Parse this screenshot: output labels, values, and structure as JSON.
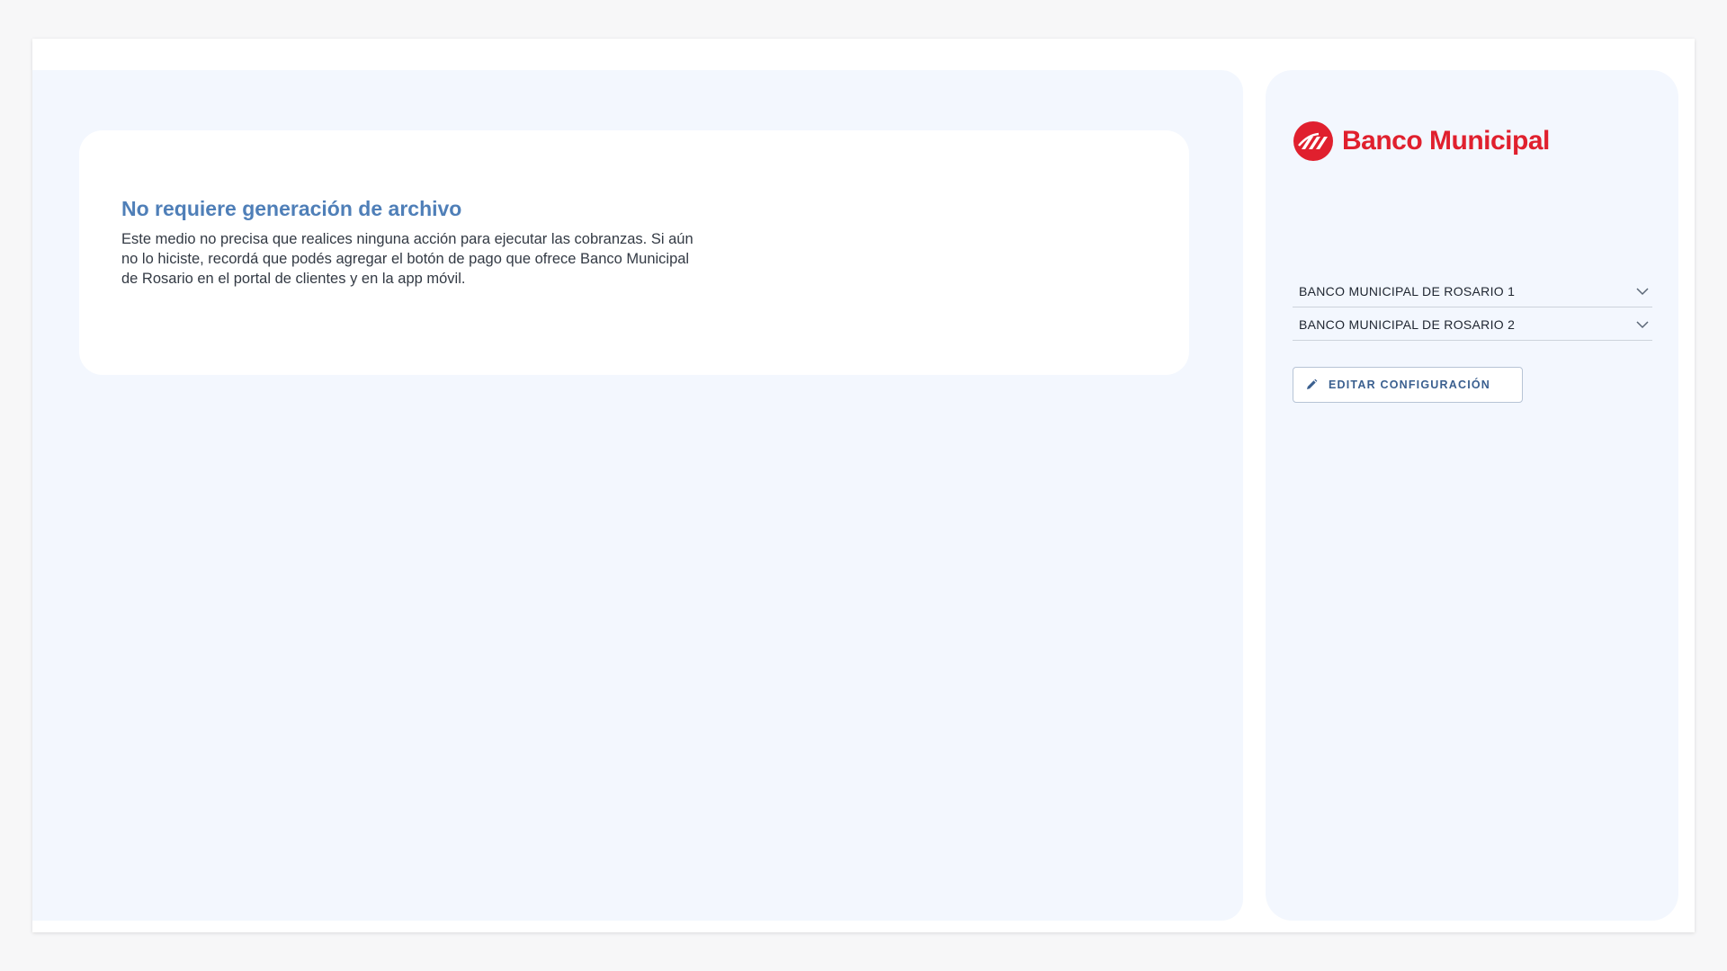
{
  "card": {
    "title": "No requiere generación de archivo",
    "body": "Este medio no precisa que realices ninguna acción para ejecutar las cobranzas. Si aún no lo hiciste, recordá que podés agregar el botón de pago que ofrece Banco Municipal de Rosario en el portal de clientes y en la app móvil."
  },
  "sidebar": {
    "logo": {
      "text": "Banco Municipal",
      "icon": "banco-municipal-logo-icon",
      "color": "#e0202e"
    },
    "accounts": [
      {
        "label": "BANCO MUNICIPAL DE ROSARIO 1",
        "icon": "chevron-down-icon"
      },
      {
        "label": "BANCO MUNICIPAL DE ROSARIO 2",
        "icon": "chevron-down-icon"
      }
    ],
    "edit_button": {
      "label": "EDITAR CONFIGURACIÓN",
      "icon": "pencil-icon"
    }
  },
  "colors": {
    "page_background": "#f7f7f8",
    "panel_background": "#f3f7fe",
    "title_blue": "#4f7fb8",
    "brand_red": "#e0202e",
    "button_text": "#3a5f8f"
  }
}
